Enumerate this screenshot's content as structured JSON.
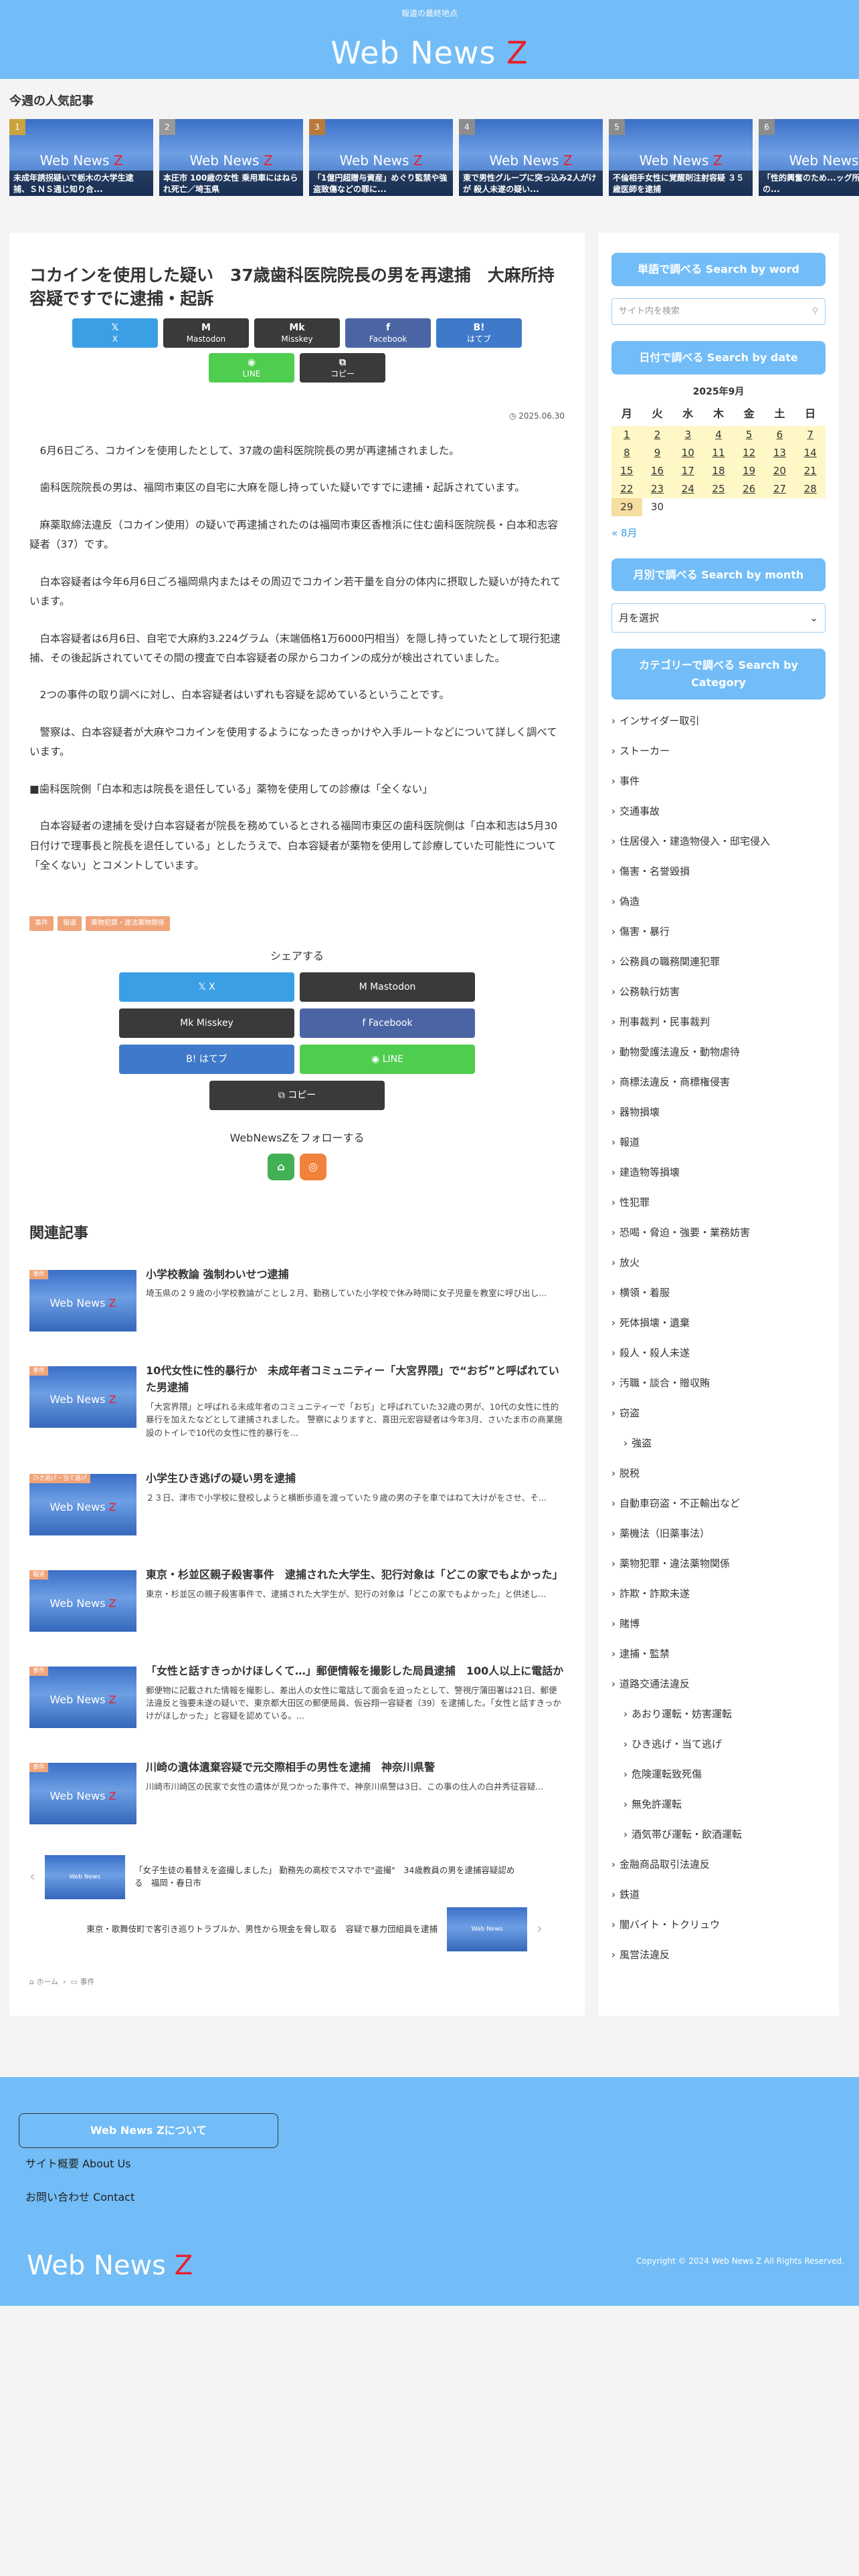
{
  "header": {
    "tagline": "報道の最終地点",
    "logo_main": "Web News ",
    "logo_z": "Z"
  },
  "popular": {
    "title": "今週の人気記事",
    "brand": "Web News ",
    "brand_z": "Z",
    "items": [
      {
        "rank": "1",
        "caption": "未成年誘拐疑いで栃木の大学生逮捕、ＳＮＳ通じ知り合..."
      },
      {
        "rank": "2",
        "caption": "本圧市 100歳の女性 乗用車にはねられ死亡／埼玉県"
      },
      {
        "rank": "3",
        "caption": "「1億円超贈与資産」めぐり監禁や強盗致傷などの罪に..."
      },
      {
        "rank": "4",
        "caption": "東で男性グループに突っ込み2人がけが 殺人未遂の疑い..."
      },
      {
        "rank": "5",
        "caption": "不倫相手女性に覚醒剤注射容疑 ３５歳医師を逮捕"
      },
      {
        "rank": "6",
        "caption": "「性的興奮のため...ッグ所持、容疑の..."
      }
    ]
  },
  "article": {
    "title": "コカインを使用した疑い　37歳歯科医院院長の男を再逮捕　大麻所持容疑ですでに逮捕・起訴",
    "date": "2025.06.30",
    "paragraphs": [
      "6月6日ごろ、コカインを使用したとして、37歳の歯科医院院長の男が再逮捕されました。",
      "歯科医院院長の男は、福岡市東区の自宅に大麻を隠し持っていた疑いですでに逮捕・起訴されています。",
      "麻薬取締法違反（コカイン使用）の疑いで再逮捕されたのは福岡市東区香椎浜に住む歯科医院院長・白本和志容疑者（37）です。",
      "白本容疑者は今年6月6日ごろ福岡県内またはその周辺でコカイン若干量を自分の体内に摂取した疑いが持たれています。",
      "白本容疑者は6月6日、自宅で大麻約3.224グラム（末端価格1万6000円相当）を隠し持っていたとして現行犯逮捕、その後起訴されていてその間の捜査で白本容疑者の尿からコカインの成分が検出されていました。",
      "2つの事件の取り調べに対し、白本容疑者はいずれも容疑を認めているということです。",
      "警察は、白本容疑者が大麻やコカインを使用するようになったきっかけや入手ルートなどについて詳しく調べています。",
      "■歯科医院側「白本和志は院長を退任している」薬物を使用しての診療は「全くない」",
      "白本容疑者の逮捕を受け白本容疑者が院長を務めているとされる福岡市東区の歯科医院側は「白本和志は5月30日付けで理事長と院長を退任している」としたうえで、白本容疑者が薬物を使用して診療していた可能性について「全くない」とコメントしています。"
    ],
    "categories": [
      "事件",
      "報道",
      "薬物犯罪・違法薬物関係"
    ]
  },
  "share": {
    "top": [
      {
        "icon": "𝕏",
        "label": "X"
      },
      {
        "icon": "M",
        "label": "Mastodon"
      },
      {
        "icon": "Mk",
        "label": "Misskey"
      },
      {
        "icon": "f",
        "label": "Facebook"
      },
      {
        "icon": "B!",
        "label": "はてブ"
      },
      {
        "icon": "◉",
        "label": "LINE"
      },
      {
        "icon": "⧉",
        "label": "コピー"
      }
    ],
    "title": "シェアする",
    "bottom": [
      "𝕏  X",
      "M  Mastodon",
      "Mk  Misskey",
      "f  Facebook",
      "B!  はてブ",
      "◉  LINE",
      "⧉  コピー"
    ]
  },
  "follow": {
    "title": "WebNewsZをフォローする"
  },
  "related": {
    "title": "関連記事",
    "items": [
      {
        "tag": "事件",
        "title": "小学校教論 強制わいせつ逮捕",
        "snippet": "埼玉県の２９歳の小学校教論がことし２月、勤務していた小学校で休み時間に女子児童を教室に呼び出し..."
      },
      {
        "tag": "事件",
        "title": "10代女性に性的暴行か　未成年者コミュニティー「大宮界隈」で“おぢ”と呼ばれていた男逮捕",
        "snippet": "「大宮界隈」と呼ばれる未成年者のコミュニティーで「おぢ」と呼ばれていた32歳の男が、10代の女性に性的暴行を加えたなどとして逮捕されました。 警察によりますと、喜田元宏容疑者は今年3月、さいたま市の商業施設のトイレで10代の女性に性的暴行を..."
      },
      {
        "tag": "ひき逃げ・当て逃げ",
        "title": "小学生ひき逃げの疑い男を逮捕",
        "snippet": "２３日、津市で小学校に登校しようと横断歩道を渡っていた９歳の男の子を車ではねて大けがをさせ、そ..."
      },
      {
        "tag": "報道",
        "title": "東京・杉並区親子殺害事件　逮捕された大学生、犯行対象は「どこの家でもよかった」",
        "snippet": "東京・杉並区の親子殺害事件で、逮捕された大学生が、犯行の対象は「どこの家でもよかった」と供述し..."
      },
      {
        "tag": "事件",
        "title": "「女性と話すきっかけほしくて…」郵便情報を撮影した局員逮捕　100人以上に電話か",
        "snippet": "郵便物に記載された情報を撮影し、差出人の女性に電話して面会を迫ったとして、警視庁蒲田署は21日、郵便法違反と強要未遂の疑いで、東京都大田区の郵便局員、仮谷翔一容疑者（39）を逮捕した。「女性と話すきっかけがほしかった」と容疑を認めている。..."
      },
      {
        "tag": "事件",
        "title": "川崎の遺体遺棄容疑で元交際相手の男性を逮捕　神奈川県警",
        "snippet": "川崎市川崎区の民家で女性の遺体が見つかった事件で、神奈川県警は3日、この事の住人の白井秀征容疑..."
      }
    ]
  },
  "prevnext": {
    "prev": "「女子生徒の着替えを盗撮しました」 勤務先の高校でスマホで\"盗撮\"　34歳教員の男を逮捕容疑認める　福岡・春日市",
    "next": "東京・歌舞伎町で客引き巡りトラブルか、男性から現金を脅し取る　容疑で暴力団組員を逮捕",
    "thumb": "Web News"
  },
  "breadcrumb": {
    "home": "⌂ ホーム",
    "sep": "›",
    "cat": "▭ 事件"
  },
  "sidebar": {
    "word_title": "単語で調べる Search by word",
    "search_placeholder": "サイト内を検索",
    "date_title": "日付で調べる Search by date",
    "calendar": {
      "caption": "2025年9月",
      "days": [
        "月",
        "火",
        "水",
        "木",
        "金",
        "土",
        "日"
      ],
      "rows": [
        [
          "1",
          "2",
          "3",
          "4",
          "5",
          "6",
          "7"
        ],
        [
          "8",
          "9",
          "10",
          "11",
          "12",
          "13",
          "14"
        ],
        [
          "15",
          "16",
          "17",
          "18",
          "19",
          "20",
          "21"
        ],
        [
          "22",
          "23",
          "24",
          "25",
          "26",
          "27",
          "28"
        ],
        [
          "29",
          "30",
          "",
          "",
          "",
          "",
          ""
        ]
      ],
      "prev": "« 8月"
    },
    "month_title": "月別で調べる Search by month",
    "month_select": "月を選択",
    "cat_title": "カテゴリーで調べる Search by Category",
    "categories": [
      {
        "label": "インサイダー取引",
        "sub": false
      },
      {
        "label": "ストーカー",
        "sub": false
      },
      {
        "label": "事件",
        "sub": false
      },
      {
        "label": "交通事故",
        "sub": false
      },
      {
        "label": "住居侵入・建造物侵入・邸宅侵入",
        "sub": false
      },
      {
        "label": "傷害・名誉毀損",
        "sub": false
      },
      {
        "label": "偽造",
        "sub": false
      },
      {
        "label": "傷害・暴行",
        "sub": false
      },
      {
        "label": "公務員の職務関連犯罪",
        "sub": false
      },
      {
        "label": "公務執行妨害",
        "sub": false
      },
      {
        "label": "刑事裁判・民事裁判",
        "sub": false
      },
      {
        "label": "動物愛護法違反・動物虐待",
        "sub": false
      },
      {
        "label": "商標法違反・商標権侵害",
        "sub": false
      },
      {
        "label": "器物損壊",
        "sub": false
      },
      {
        "label": "報道",
        "sub": false
      },
      {
        "label": "建造物等損壊",
        "sub": false
      },
      {
        "label": "性犯罪",
        "sub": false
      },
      {
        "label": "恐喝・脅迫・強要・業務妨害",
        "sub": false
      },
      {
        "label": "放火",
        "sub": false
      },
      {
        "label": "横領・着服",
        "sub": false
      },
      {
        "label": "死体損壊・遺棄",
        "sub": false
      },
      {
        "label": "殺人・殺人未遂",
        "sub": false
      },
      {
        "label": "汚職・談合・贈収賄",
        "sub": false
      },
      {
        "label": "窃盗",
        "sub": false
      },
      {
        "label": "強盗",
        "sub": true
      },
      {
        "label": "脱税",
        "sub": false
      },
      {
        "label": "自動車窃盗・不正輸出など",
        "sub": false
      },
      {
        "label": "薬機法（旧薬事法）",
        "sub": false
      },
      {
        "label": "薬物犯罪・違法薬物関係",
        "sub": false
      },
      {
        "label": "詐欺・詐欺未遂",
        "sub": false
      },
      {
        "label": "賭博",
        "sub": false
      },
      {
        "label": "逮捕・監禁",
        "sub": false
      },
      {
        "label": "道路交通法違反",
        "sub": false
      },
      {
        "label": "あおり運転・妨害運転",
        "sub": true
      },
      {
        "label": "ひき逃げ・当て逃げ",
        "sub": true
      },
      {
        "label": "危険運転致死傷",
        "sub": true
      },
      {
        "label": "無免許運転",
        "sub": true
      },
      {
        "label": "酒気帯び運転・飲酒運転",
        "sub": true
      },
      {
        "label": "金融商品取引法違反",
        "sub": false
      },
      {
        "label": "鉄道",
        "sub": false
      },
      {
        "label": "闇バイト・トクリュウ",
        "sub": false
      },
      {
        "label": "風営法違反",
        "sub": false
      }
    ]
  },
  "footer": {
    "about": "Web News Zについて",
    "link1": "サイト概要 About Us",
    "link2": "お問い合わせ Contact",
    "logo_main": "Web News ",
    "logo_z": "Z",
    "copyright": "Copyright © 2024 Web News Z All Rights Reserved."
  }
}
